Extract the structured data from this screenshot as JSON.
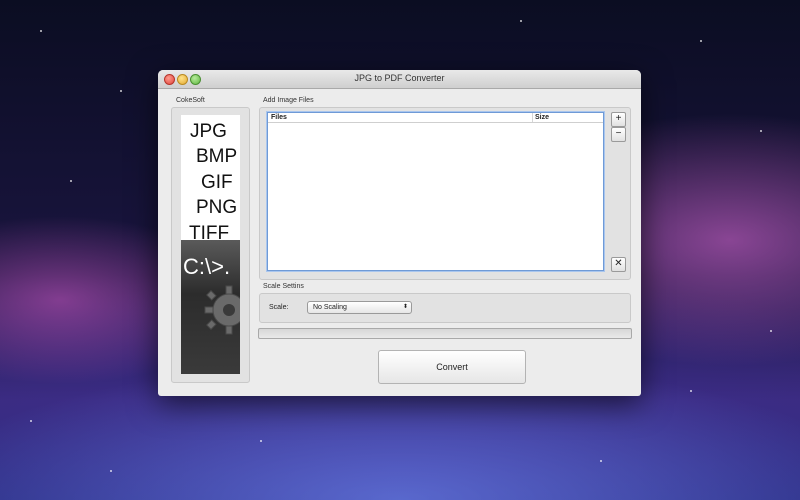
{
  "window": {
    "title": "JPG to PDF Converter"
  },
  "sidebar": {
    "group_label": "CokeSoft",
    "formats": [
      "JPG",
      "BMP",
      "GIF",
      "PNG",
      "TIFF"
    ],
    "terminal_text": "C:\\>."
  },
  "files": {
    "group_label": "Add Image Files",
    "columns": {
      "files": "Files",
      "size": "Size"
    },
    "add_label": "+",
    "remove_label": "−",
    "clear_label": "✕"
  },
  "scale": {
    "group_label": "Scale Settins",
    "label": "Scale:",
    "selected": "No Scaling",
    "arrows": "⬍"
  },
  "progress": {
    "value": 0
  },
  "convert": {
    "label": "Convert"
  }
}
